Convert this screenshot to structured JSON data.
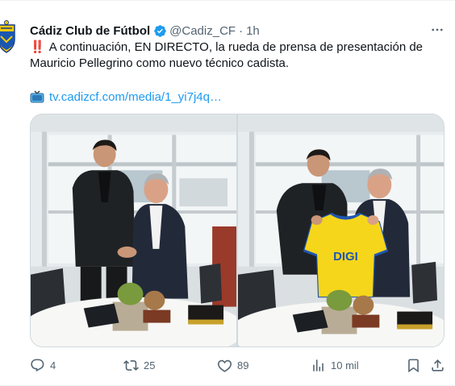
{
  "tweet": {
    "author": {
      "display_name": "Cádiz Club de Fútbol",
      "handle": "@Cadiz_CF",
      "time": "1h",
      "verified": true,
      "avatar_icon": "cadiz-crest-icon"
    },
    "dot": "·",
    "more_icon": "more-horizontal-icon",
    "text": {
      "emoji": "‼️",
      "body": "A continuación, EN DIRECTO, la rueda de prensa de presentación de Mauricio Pellegrino como nuevo técnico cadista."
    },
    "link": {
      "icon": "tv-icon",
      "text": "tv.cadizcf.com/media/1_yi7j4q…"
    },
    "media": [
      {
        "photo_icon": "photo-handshake"
      },
      {
        "photo_icon": "photo-jersey-presentation",
        "jersey_text": "DIGI"
      }
    ],
    "actions": {
      "replies": "4",
      "retweets": "25",
      "likes": "89",
      "views": "10 mil"
    },
    "colors": {
      "accent": "#1d9bf0",
      "text": "#0f1419",
      "muted": "#536471",
      "border": "#cfd9de",
      "jersey": "#f6d61a"
    }
  }
}
